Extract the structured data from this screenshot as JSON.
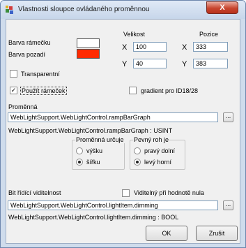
{
  "window": {
    "title": "Vlastnosti sloupce ovládaného proměnnou",
    "close_glyph": "X"
  },
  "colors": {
    "frame_color": "#ffffff",
    "background_color": "#ff2a00"
  },
  "labels": {
    "frame_color": "Barva rámečku",
    "background_color": "Barva pozadí",
    "size": "Velikost",
    "position": "Pozice",
    "x": "X",
    "y": "Y"
  },
  "fields": {
    "size_x": "100",
    "size_y": "40",
    "pos_x": "333",
    "pos_y": "383"
  },
  "checkboxes": {
    "transparent": {
      "label": "Transparentní",
      "checked": false,
      "mark": ""
    },
    "use_frame": {
      "label": "Použít rámeček",
      "checked": true,
      "mark": "✓"
    },
    "gradient": {
      "label": "gradient pro ID18/28",
      "checked": false,
      "mark": ""
    },
    "visible_zero": {
      "label": "Viditelný při hodnotě nula",
      "checked": false,
      "mark": ""
    }
  },
  "variable": {
    "label": "Proměnná",
    "value": "WebLightSupport.WebLightControl.rampBarGraph",
    "type_info": "WebLightSupport.WebLightControl.rampBarGraph : USINT",
    "browse": "..."
  },
  "group_determines": {
    "legend": "Proměnná určuje",
    "options": [
      "výšku",
      "šířku"
    ],
    "selected": 1
  },
  "group_fixed_corner": {
    "legend": "Pevný roh je",
    "options": [
      "pravý dolní",
      "levý horní"
    ],
    "selected": 1
  },
  "visibility": {
    "label": "Bit řídící viditelnost",
    "value": "WebLightSupport.WebLightControl.lightItem.dimming",
    "type_info": "WebLightSupport.WebLightControl.lightItem.dimming : BOOL",
    "browse": "..."
  },
  "buttons": {
    "ok": "OK",
    "cancel": "Zrušit"
  }
}
